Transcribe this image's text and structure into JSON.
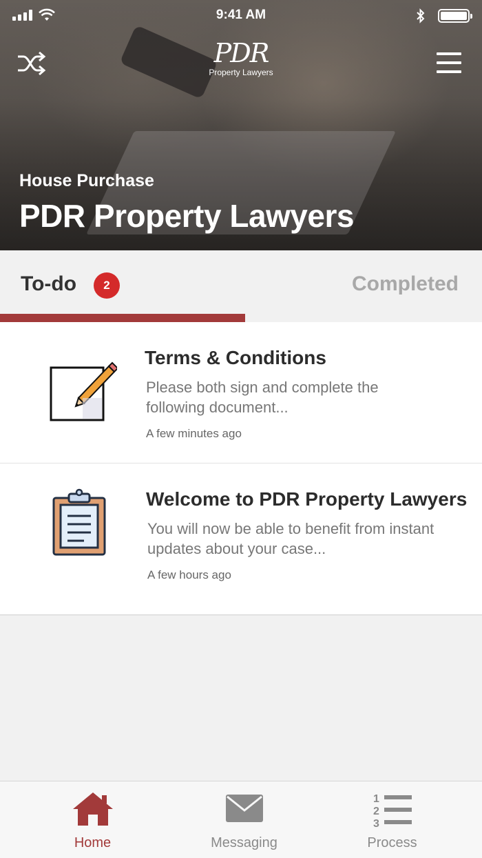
{
  "status_bar": {
    "time": "9:41 AM"
  },
  "header": {
    "logo_mark": "PDR",
    "logo_sub": "Property Lawyers",
    "subtitle": "House Purchase",
    "title": "PDR Property Lawyers"
  },
  "tabs": {
    "todo_label": "To-do",
    "todo_count": "2",
    "completed_label": "Completed"
  },
  "items": [
    {
      "title": "Terms & Conditions",
      "body": "Please both sign and complete the following document...",
      "time": "A few minutes ago",
      "icon": "edit-document-icon"
    },
    {
      "title": "Welcome to PDR Property Lawyers",
      "body": "You will now be able to benefit from instant updates about your case...",
      "time": "A few hours ago",
      "icon": "clipboard-icon"
    }
  ],
  "bottom_nav": {
    "home": "Home",
    "messaging": "Messaging",
    "process": "Process"
  },
  "colors": {
    "accent": "#a23a3a",
    "badge": "#d42a2a",
    "muted": "#8a8a8a"
  }
}
